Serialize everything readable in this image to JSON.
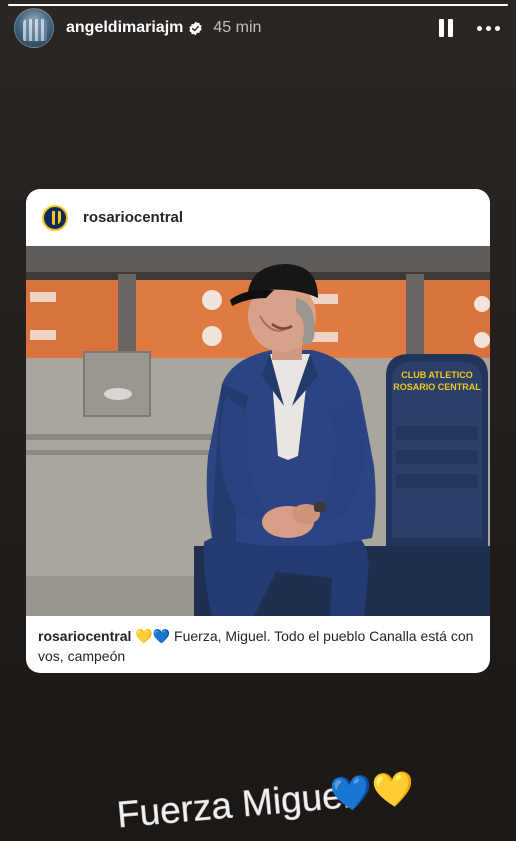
{
  "story": {
    "progress_fraction": 1.0
  },
  "header": {
    "username": "angeldimariajm",
    "timestamp": "45 min",
    "verified_icon": "verified-badge-icon",
    "pause_icon": "pause-icon",
    "more_icon": "more-options-icon"
  },
  "post": {
    "username": "rosariocentral",
    "logo_icon": "club-logo",
    "photo_sign_text": "CLUB ATLETICO\nROSARIO CENTRAL",
    "caption_user": "rosariocentral",
    "caption_emojis": "💛💙",
    "caption_text": " Fuerza, Miguel. Todo el pueblo Canalla está con vos, campeón"
  },
  "sticker": {
    "text": "Fuerza Miguel",
    "emojis": "💙💛"
  },
  "colors": {
    "background": "#231e1c",
    "card": "#ffffff",
    "club_blue": "#0e2a5c",
    "club_yellow": "#f2c81c"
  }
}
